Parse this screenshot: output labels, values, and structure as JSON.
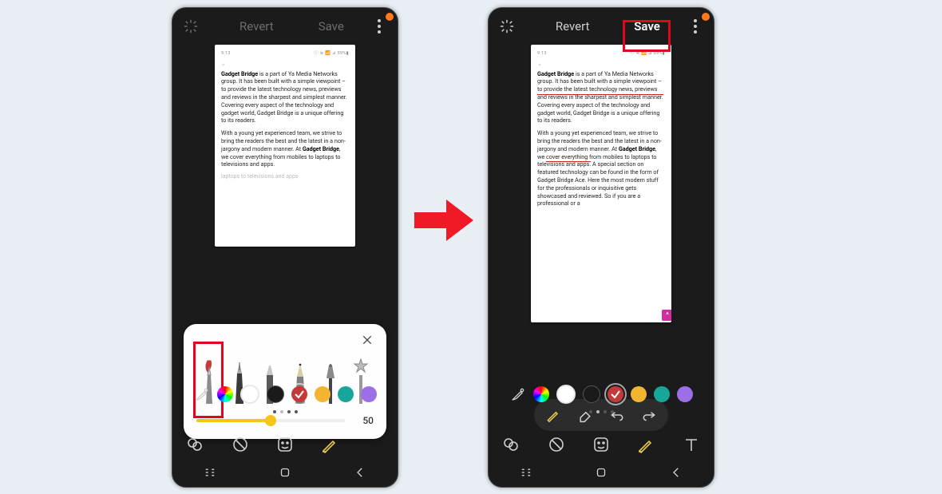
{
  "topbar": {
    "revert_label": "Revert",
    "save_label": "Save"
  },
  "status": {
    "time": "9:13",
    "right": "ⓘ ≋ 📶 ⊿ 59%▮"
  },
  "document": {
    "p1_bold": "Gadget Bridge",
    "p1_rest": " is a part of Ya Media Networks group. It has been built with a simple viewpoint – ",
    "p1_strike": "to provide the latest technology news, previews and reviews in the sharpest and simplest manner.",
    "p1_tail": " Covering every aspect of the technology and gadget world, Gadget Bridge is a unique offering to its readers.",
    "p2_head": "With a young yet experienced team, we strive to bring the readers the best and the latest in a non-jargony and modern manner. At ",
    "p2_bold": "Gadget Bridge",
    "p2_mid": ", we ",
    "p2_strike": "cover everything from mobiles to laptops to televisions and apps.",
    "p2_tail": " A special section on featured technology can be found in the form of Gadget Bridge Ace. Here the most modern stuff for the professionals or inquisitive gets showcased and reviewed. So if you are a professional or a",
    "p2_tail_cut": "laptops to televisions and apps"
  },
  "brush": {
    "value": "50"
  },
  "colors": [
    "rainbow",
    "#ffffff",
    "#1a1a1a",
    "#c43a3a",
    "#f2b431",
    "#18a59a",
    "#9d6fe6"
  ],
  "selected_color_index": 3
}
